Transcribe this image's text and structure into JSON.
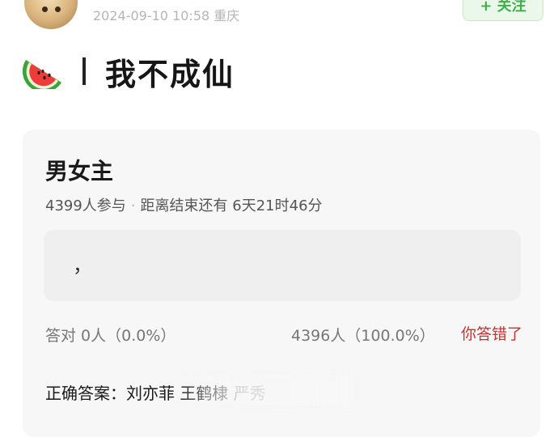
{
  "post": {
    "meta": "2024-09-10 10:58  重庆",
    "follow_label": "+ 关注",
    "title": "我不成仙"
  },
  "vote": {
    "title": "男女主",
    "participants": "4399人参与",
    "separator": "·",
    "remaining": "距离结束还有 6天21时46分",
    "option_text": "，",
    "correct_result": "答对  0人（0.0%）",
    "wrong_result": "4396人（100.0%）",
    "wrong_badge": "你答错了",
    "answer_label": "正确答案：",
    "answer_value": "刘亦菲 王鹤棣 严秀"
  },
  "colors": {
    "follow_green": "#3fb04a",
    "wrong_red": "#c2362f",
    "card_bg": "#f7f7f7"
  },
  "icons": [
    "avatar",
    "watermelon-icon"
  ]
}
